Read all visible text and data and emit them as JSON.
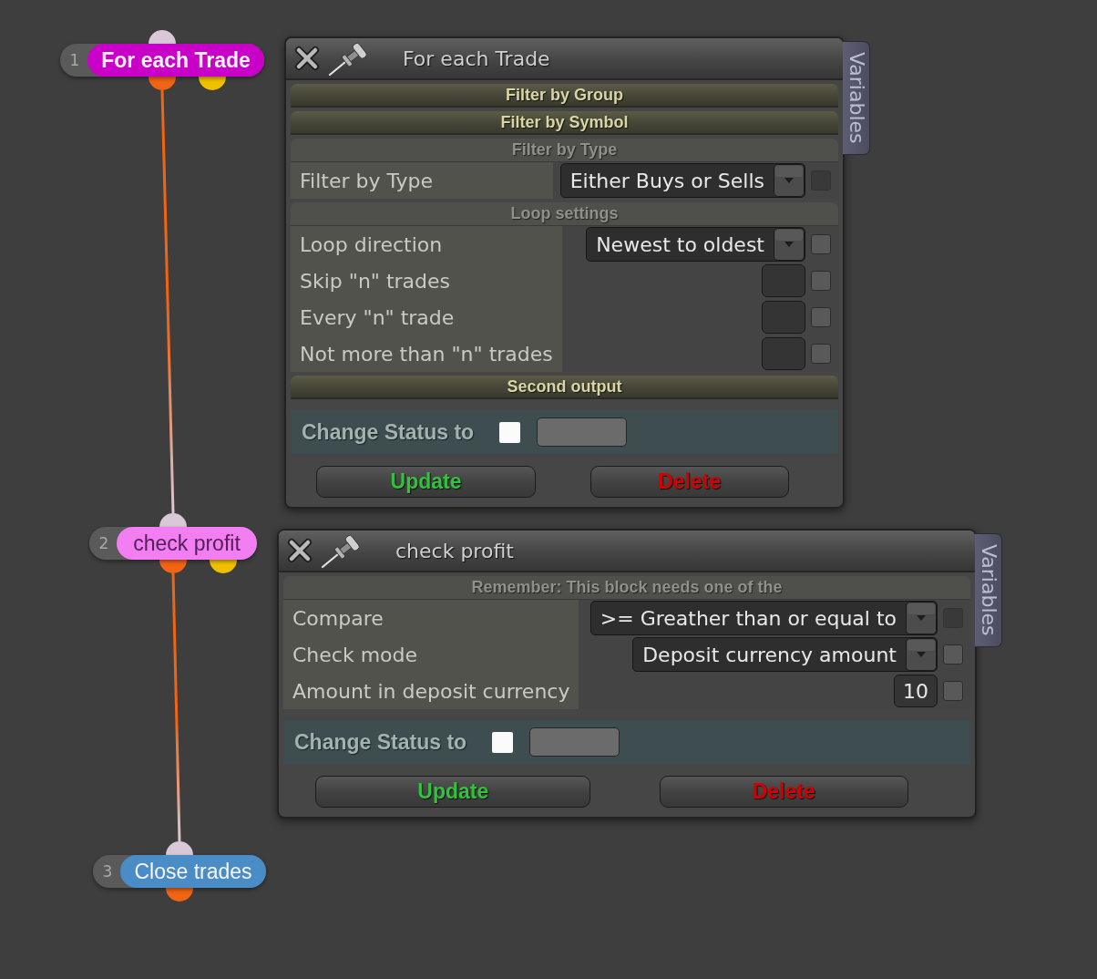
{
  "nodes": [
    {
      "number": "1",
      "label": "For each Trade",
      "color": "#c800c8",
      "selected": true,
      "input": {
        "color": "#d8c8d8"
      },
      "outputs": [
        {
          "color": "#f06414",
          "connected": true
        },
        {
          "color": "#f0c000",
          "connected": false
        }
      ]
    },
    {
      "number": "2",
      "label": "check profit",
      "color": "#f27ef2",
      "selected": false,
      "input": {
        "color": "#d8c8d8"
      },
      "outputs": [
        {
          "color": "#f06414",
          "connected": true
        },
        {
          "color": "#f0c000",
          "connected": false
        }
      ]
    },
    {
      "number": "3",
      "label": "Close trades",
      "color": "#4a8cc6",
      "selected": false,
      "input": {
        "color": "#d8c8d8"
      },
      "outputs": [
        {
          "color": "#f06414",
          "connected": false
        }
      ]
    }
  ],
  "panels": [
    {
      "title": "For each Trade",
      "side_tab": "Variables",
      "sections": [
        {
          "title": "Filter by Group",
          "expanded": false
        },
        {
          "title": "Filter by Symbol",
          "expanded": false
        },
        {
          "title": "Filter by Type",
          "expanded": true,
          "rows": [
            {
              "label": "Filter by Type",
              "kind": "dropdown",
              "value": "Either Buys or Sells",
              "checkbox": {
                "checked": false,
                "disabled": true
              }
            }
          ]
        },
        {
          "title": "Loop settings",
          "expanded": true,
          "rows": [
            {
              "label": "Loop direction",
              "kind": "dropdown",
              "value": "Newest to oldest",
              "checkbox": {
                "checked": false,
                "disabled": false
              }
            },
            {
              "label": "Skip \"n\" trades",
              "kind": "number",
              "checkbox": {
                "checked": false,
                "disabled": false
              }
            },
            {
              "label": "Every \"n\" trade",
              "kind": "number",
              "checkbox": {
                "checked": false,
                "disabled": false
              }
            },
            {
              "label": "Not more than \"n\" trades",
              "kind": "number",
              "checkbox": {
                "checked": false,
                "disabled": false
              }
            }
          ]
        },
        {
          "title": "Second output",
          "expanded": false
        }
      ],
      "status": {
        "label": "Change Status to",
        "checked": false
      },
      "buttons": [
        {
          "label": "Update",
          "kind": "update"
        },
        {
          "label": "Delete",
          "kind": "delete"
        }
      ]
    },
    {
      "title": "check profit",
      "side_tab": "Variables",
      "sections": [
        {
          "title": "Remember: This block needs one of the",
          "expanded": true,
          "rows": [
            {
              "label": "Compare",
              "kind": "dropdown",
              "value": ">= Greather than or equal to",
              "checkbox": {
                "checked": false,
                "disabled": true
              }
            },
            {
              "label": "Check mode",
              "kind": "dropdown",
              "value": "Deposit currency amount",
              "checkbox": {
                "checked": false,
                "disabled": false
              }
            },
            {
              "label": "Amount in deposit currency",
              "kind": "number",
              "value": "10",
              "checkbox": {
                "checked": false,
                "disabled": false
              }
            }
          ]
        }
      ],
      "status": {
        "label": "Change Status to",
        "checked": false
      },
      "buttons": [
        {
          "label": "Update",
          "kind": "update"
        },
        {
          "label": "Delete",
          "kind": "delete"
        }
      ]
    }
  ]
}
